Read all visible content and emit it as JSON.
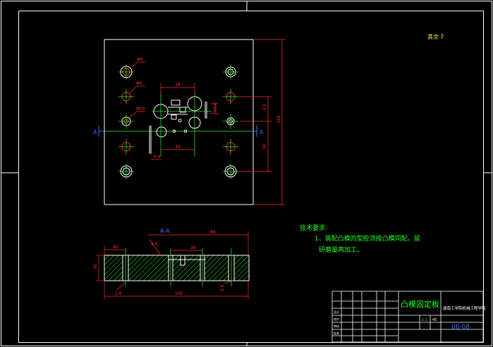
{
  "colors": {
    "background": "#000000",
    "outline": "#ffffff",
    "dimension": "#ff2a2a",
    "construction": "#22ff22",
    "section_hatch": "#22ff22",
    "label_blue": "#3b6bff",
    "title_yellow": "#ffe14a"
  },
  "roughness_note": "其余 ∛",
  "top_view": {
    "section_marker_left": "A",
    "section_marker_right": "A",
    "dims": {
      "d1": "Φ8",
      "d2": "Φ6",
      "d3": "Φ10",
      "w_top": "38",
      "h_right1": "10.8",
      "h_right2": "3.5",
      "h_right3": "90",
      "w_bottom": "30",
      "w_small": "4.4",
      "overall_h": "160"
    }
  },
  "section_view": {
    "label": "A-A",
    "dims": {
      "left": "40",
      "top_total": "88",
      "mid": "36",
      "mid2": "4.6",
      "height": "30",
      "r1": "1.6",
      "r2": "0.8",
      "bottom": "160"
    }
  },
  "tech_req": {
    "title": "技术要求:",
    "line1": "1、装配凸模的型腔须按凸模同配，留",
    "line2": "研磨量再加工。"
  },
  "title_block": {
    "name": "凸模固定板",
    "school": "湖南工学院机械工程学院",
    "drawing_no": "06-08",
    "scale": "1:1",
    "material": "45",
    "labels": [
      "设计",
      "校对",
      "审核",
      "批准"
    ]
  }
}
